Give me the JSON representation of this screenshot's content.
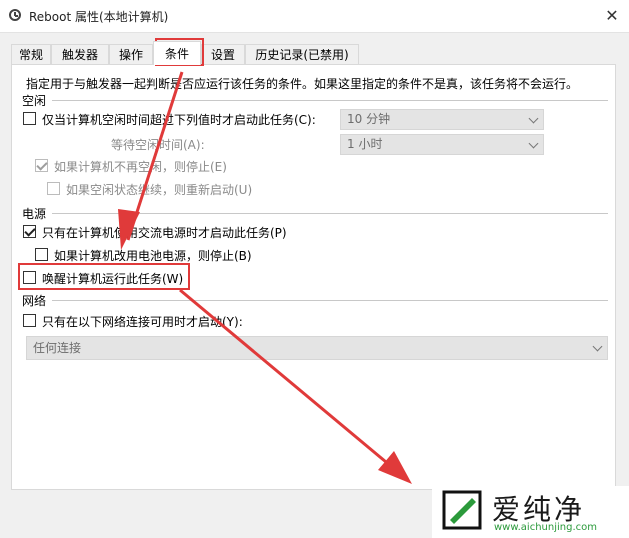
{
  "window": {
    "title": "Reboot 属性(本地计算机)",
    "close_glyph": "✕"
  },
  "tabs": [
    {
      "label": "常规",
      "active": false
    },
    {
      "label": "触发器",
      "active": false
    },
    {
      "label": "操作",
      "active": false
    },
    {
      "label": "条件",
      "active": true
    },
    {
      "label": "设置",
      "active": false
    },
    {
      "label": "历史记录(已禁用)",
      "active": false
    }
  ],
  "conditions": {
    "description": "指定用于与触发器一起判断是否应运行该任务的条件。如果这里指定的条件不是真，该任务将不会运行。",
    "idle": {
      "section_label": "空闲",
      "start_if_idle": {
        "label": "仅当计算机空闲时间超过下列值时才启动此任务(C):",
        "checked": false
      },
      "idle_duration_value": "10 分钟",
      "wait_for_idle_label": "等待空闲时间(A):",
      "wait_for_idle_value": "1 小时",
      "stop_if_not_idle": {
        "label": "如果计算机不再空闲，则停止(E)",
        "checked": true,
        "disabled": true
      },
      "restart_if_idle_resumes": {
        "label": "如果空闲状态继续，则重新启动(U)",
        "checked": false,
        "disabled": true
      }
    },
    "power": {
      "section_label": "电源",
      "ac_power_only": {
        "label": "只有在计算机使用交流电源时才启动此任务(P)",
        "checked": true
      },
      "stop_on_battery": {
        "label": "如果计算机改用电池电源，则停止(B)",
        "checked": false
      },
      "wake_to_run": {
        "label": "唤醒计算机运行此任务(W)",
        "checked": false
      }
    },
    "network": {
      "section_label": "网络",
      "start_only_if_network": {
        "label": "只有在以下网络连接可用时才启动(Y):",
        "checked": false
      },
      "network_value": "任何连接"
    }
  },
  "watermark": {
    "brand": "爱纯净",
    "url": "www.aichunjing.com",
    "brand_color": "#2b9a3b"
  },
  "annotation": {
    "color": "#e03a3a"
  }
}
